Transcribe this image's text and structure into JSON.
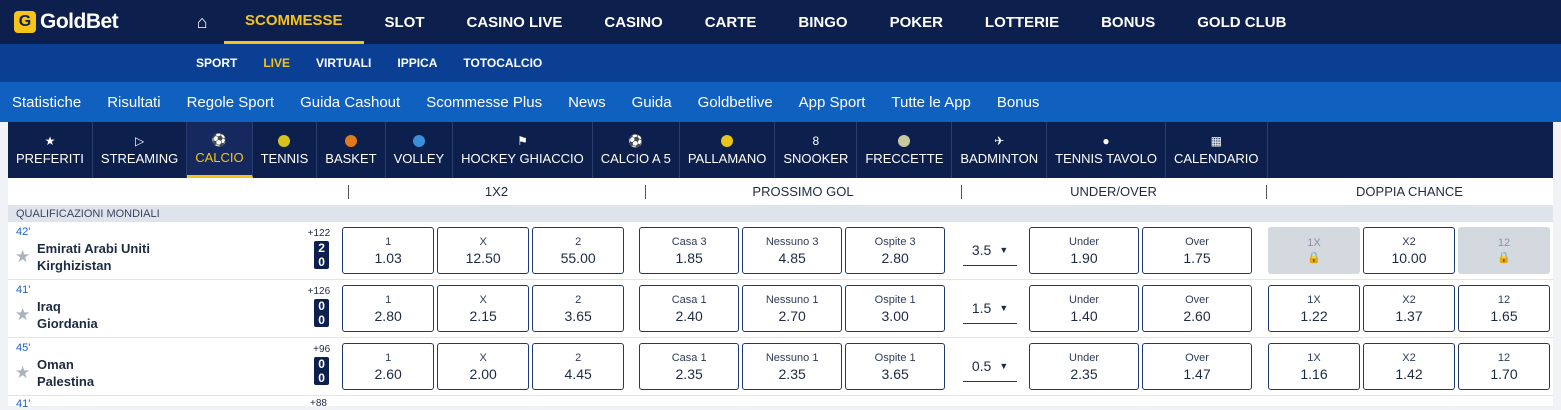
{
  "brand": {
    "logo_letter": "G",
    "name": "GoldBet"
  },
  "nav": {
    "items": [
      "SCOMMESSE",
      "SLOT",
      "CASINO LIVE",
      "CASINO",
      "CARTE",
      "BINGO",
      "POKER",
      "LOTTERIE",
      "BONUS",
      "GOLD CLUB"
    ],
    "active": "SCOMMESSE"
  },
  "subnav": {
    "items": [
      "SPORT",
      "LIVE",
      "VIRTUALI",
      "IPPICA",
      "TOTOCALCIO"
    ],
    "active": "LIVE"
  },
  "links": [
    "Statistiche",
    "Risultati",
    "Regole Sport",
    "Guida Cashout",
    "Scommesse Plus",
    "News",
    "Guida",
    "Goldbetlive",
    "App Sport",
    "Tutte le App",
    "Bonus"
  ],
  "sports": [
    {
      "label": "PREFERITI",
      "icon": "star-icon",
      "glyph": "★"
    },
    {
      "label": "STREAMING",
      "icon": "play-icon",
      "glyph": "▷"
    },
    {
      "label": "CALCIO",
      "icon": "soccer-ball-icon",
      "glyph": "⚽"
    },
    {
      "label": "TENNIS",
      "icon": "tennis-ball-icon",
      "glyph": ""
    },
    {
      "label": "BASKET",
      "icon": "basketball-icon",
      "glyph": ""
    },
    {
      "label": "VOLLEY",
      "icon": "volleyball-icon",
      "glyph": ""
    },
    {
      "label": "HOCKEY GHIACCIO",
      "icon": "hockey-stick-icon",
      "glyph": "⚑"
    },
    {
      "label": "CALCIO A 5",
      "icon": "futsal-ball-icon",
      "glyph": "⚽"
    },
    {
      "label": "PALLAMANO",
      "icon": "handball-icon",
      "glyph": ""
    },
    {
      "label": "SNOOKER",
      "icon": "snooker-ball-icon",
      "glyph": "8"
    },
    {
      "label": "FRECCETTE",
      "icon": "dartboard-icon",
      "glyph": ""
    },
    {
      "label": "BADMINTON",
      "icon": "shuttlecock-icon",
      "glyph": "✈"
    },
    {
      "label": "TENNIS TAVOLO",
      "icon": "ping-pong-icon",
      "glyph": "●"
    },
    {
      "label": "CALENDARIO",
      "icon": "calendar-icon",
      "glyph": "▦"
    }
  ],
  "active_sport": "CALCIO",
  "markets": [
    "1X2",
    "PROSSIMO GOL",
    "UNDER/OVER",
    "DOPPIA CHANCE"
  ],
  "league": "QUALIFICAZIONI MONDIALI",
  "matches": [
    {
      "minute": "42'",
      "home": "Emirati Arabi Uniti",
      "away": "Kirghizistan",
      "extra": "+122",
      "score_home": "2",
      "score_away": "0",
      "x12": [
        {
          "l": "1",
          "v": "1.03"
        },
        {
          "l": "X",
          "v": "12.50"
        },
        {
          "l": "2",
          "v": "55.00"
        }
      ],
      "next_goal": [
        {
          "l": "Casa 3",
          "v": "1.85"
        },
        {
          "l": "Nessuno 3",
          "v": "4.85"
        },
        {
          "l": "Ospite 3",
          "v": "2.80"
        }
      ],
      "line": "3.5",
      "uo": [
        {
          "l": "Under",
          "v": "1.90"
        },
        {
          "l": "Over",
          "v": "1.75"
        }
      ],
      "dc": [
        {
          "l": "1X",
          "v": "",
          "locked": true
        },
        {
          "l": "X2",
          "v": "10.00",
          "locked": false
        },
        {
          "l": "12",
          "v": "",
          "locked": true
        }
      ]
    },
    {
      "minute": "41'",
      "home": "Iraq",
      "away": "Giordania",
      "extra": "+126",
      "score_home": "0",
      "score_away": "0",
      "x12": [
        {
          "l": "1",
          "v": "2.80"
        },
        {
          "l": "X",
          "v": "2.15"
        },
        {
          "l": "2",
          "v": "3.65"
        }
      ],
      "next_goal": [
        {
          "l": "Casa 1",
          "v": "2.40"
        },
        {
          "l": "Nessuno 1",
          "v": "2.70"
        },
        {
          "l": "Ospite 1",
          "v": "3.00"
        }
      ],
      "line": "1.5",
      "uo": [
        {
          "l": "Under",
          "v": "1.40"
        },
        {
          "l": "Over",
          "v": "2.60"
        }
      ],
      "dc": [
        {
          "l": "1X",
          "v": "1.22",
          "locked": false
        },
        {
          "l": "X2",
          "v": "1.37",
          "locked": false
        },
        {
          "l": "12",
          "v": "1.65",
          "locked": false
        }
      ]
    },
    {
      "minute": "45'",
      "home": "Oman",
      "away": "Palestina",
      "extra": "+96",
      "score_home": "0",
      "score_away": "0",
      "x12": [
        {
          "l": "1",
          "v": "2.60"
        },
        {
          "l": "X",
          "v": "2.00"
        },
        {
          "l": "2",
          "v": "4.45"
        }
      ],
      "next_goal": [
        {
          "l": "Casa 1",
          "v": "2.35"
        },
        {
          "l": "Nessuno 1",
          "v": "2.35"
        },
        {
          "l": "Ospite 1",
          "v": "3.65"
        }
      ],
      "line": "0.5",
      "uo": [
        {
          "l": "Under",
          "v": "2.35"
        },
        {
          "l": "Over",
          "v": "1.47"
        }
      ],
      "dc": [
        {
          "l": "1X",
          "v": "1.16",
          "locked": false
        },
        {
          "l": "X2",
          "v": "1.42",
          "locked": false
        },
        {
          "l": "12",
          "v": "1.70",
          "locked": false
        }
      ]
    }
  ],
  "partial_row": {
    "minute": "41'",
    "extra": "+88"
  },
  "colors": {
    "navy": "#0d1f4d",
    "gold": "#f6c31a",
    "blue": "#0a3f94",
    "link_blue": "#1060c0"
  }
}
